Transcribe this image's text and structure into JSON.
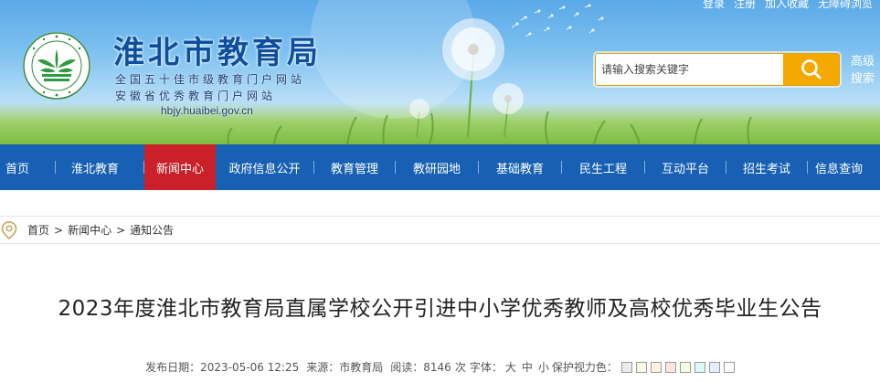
{
  "top_links": [
    "登录",
    "注册",
    "加入收藏",
    "无障碍浏览"
  ],
  "site": {
    "name": "淮北市教育局",
    "subtitle_1": "全国五十佳市级教育门户网站",
    "subtitle_2": "安徽省优秀教育门户网站",
    "domain": "hbjy.huaibei.gov.cn"
  },
  "search": {
    "placeholder": "请输入搜索关键字",
    "icon": "search-icon",
    "advanced_label": "高级搜索"
  },
  "nav": {
    "items": [
      {
        "label": "首页",
        "active": false
      },
      {
        "label": "淮北教育",
        "active": false
      },
      {
        "label": "新闻中心",
        "active": true
      },
      {
        "label": "政府信息公开",
        "active": false
      },
      {
        "label": "教育管理",
        "active": false
      },
      {
        "label": "教研园地",
        "active": false
      },
      {
        "label": "基础教育",
        "active": false
      },
      {
        "label": "民生工程",
        "active": false
      },
      {
        "label": "互动平台",
        "active": false
      },
      {
        "label": "招生考试",
        "active": false
      },
      {
        "label": "信息查询",
        "active": false
      }
    ]
  },
  "breadcrumb": {
    "icon": "location-pin-icon",
    "items": [
      "首页",
      "新闻中心",
      "通知公告"
    ],
    "separator": ">"
  },
  "article": {
    "title": "2023年度淮北市教育局直属学校公开引进中小学优秀教师及高校优秀毕业生公告",
    "meta": {
      "date_label": "发布日期：",
      "date": "2023-05-06 12:25",
      "source_label": "来源：",
      "source": "市教育局",
      "reads_label": "阅读：",
      "reads": "8146",
      "reads_unit": "次",
      "font_label": "字体：",
      "font_sizes": [
        "大",
        "中",
        "小"
      ],
      "eye_label": "保护视力色：",
      "eye_colors": [
        "#ebeaea",
        "#fafbe6",
        "#fff2e2",
        "#fde6e0",
        "#f3ffe1",
        "#dafaf6",
        "#e9ebfe",
        "#ffffff"
      ]
    }
  },
  "colors": {
    "nav_bg": "#1760b3",
    "nav_active": "#c9202a",
    "search_button": "#f5a800",
    "site_name": "#0d4f9e"
  }
}
